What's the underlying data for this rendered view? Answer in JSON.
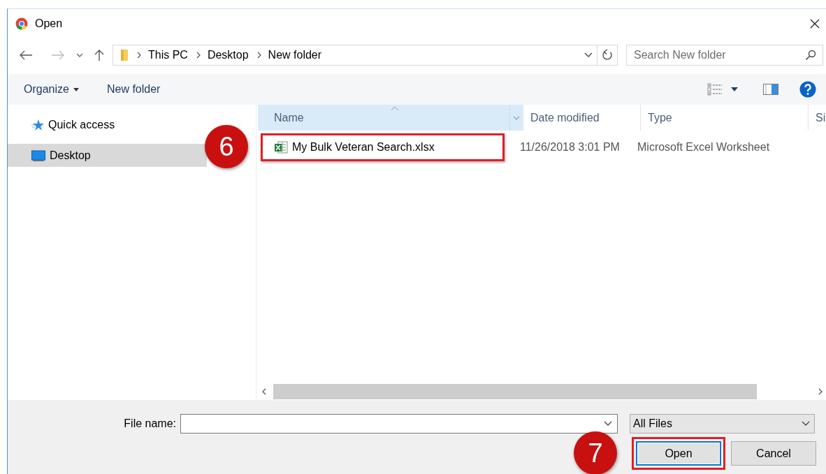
{
  "window": {
    "title": "Open"
  },
  "address_bar": {
    "path": [
      {
        "label": "This PC"
      },
      {
        "label": "Desktop"
      },
      {
        "label": "New folder"
      }
    ]
  },
  "search": {
    "placeholder": "Search New folder"
  },
  "toolbar": {
    "buttons": [
      {
        "label": "Organize",
        "kind": "menu"
      },
      {
        "label": "New folder",
        "kind": "plain"
      }
    ]
  },
  "sidebar": {
    "items": [
      {
        "label": "Quick access",
        "kind": "star",
        "selected": false
      },
      {
        "label": "Desktop",
        "kind": "desktop",
        "selected": true
      }
    ]
  },
  "file_list": {
    "columns": [
      {
        "label": "Name",
        "sorted": true
      },
      {
        "label": "Date modified",
        "sorted": false
      },
      {
        "label": "Type",
        "sorted": false
      },
      {
        "label": "Si",
        "sorted": false
      }
    ],
    "rows": [
      {
        "name": "My Bulk Veteran Search.xlsx",
        "date_modified": "11/26/2018 3:01 PM",
        "type": "Microsoft Excel Worksheet",
        "highlighted": true,
        "callout": "6"
      }
    ]
  },
  "file_name": {
    "label": "File name:"
  },
  "file_type": {
    "value": "All Files"
  },
  "buttons": [
    {
      "label": "Open",
      "kind": "primary",
      "highlighted": true,
      "callout": "7"
    },
    {
      "label": "Cancel",
      "kind": "normal",
      "highlighted": false
    }
  ]
}
